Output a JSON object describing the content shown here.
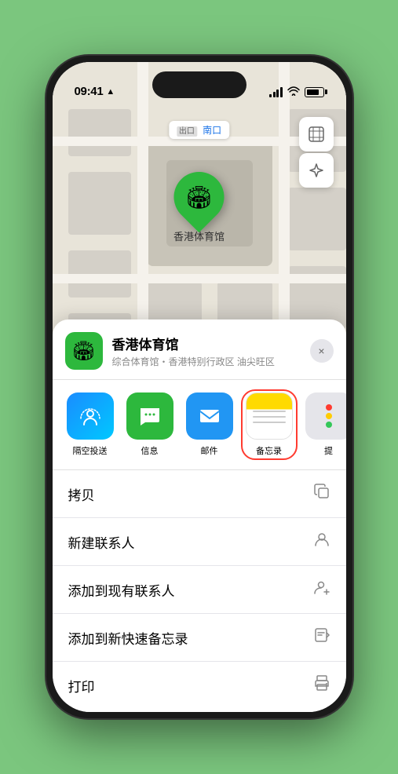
{
  "status_bar": {
    "time": "09:41",
    "location_arrow": "▶"
  },
  "map": {
    "label_prefix": "出口",
    "label_text": "南口",
    "map_label_full": "出口 南口"
  },
  "controls": {
    "map_btn": "🗺",
    "location_btn": "⬆"
  },
  "marker": {
    "label": "香港体育馆"
  },
  "sheet": {
    "venue_icon": "🏟",
    "venue_name": "香港体育馆",
    "venue_subtitle": "综合体育馆・香港特别行政区 油尖旺区",
    "close_label": "×"
  },
  "share_items": [
    {
      "id": "airdrop",
      "label": "隔空投送",
      "type": "airdrop"
    },
    {
      "id": "messages",
      "label": "信息",
      "type": "messages"
    },
    {
      "id": "mail",
      "label": "邮件",
      "type": "mail"
    },
    {
      "id": "notes",
      "label": "备忘录",
      "type": "notes",
      "selected": true
    },
    {
      "id": "more",
      "label": "提",
      "type": "more"
    }
  ],
  "actions": [
    {
      "label": "拷贝",
      "icon": "copy"
    },
    {
      "label": "新建联系人",
      "icon": "person"
    },
    {
      "label": "添加到现有联系人",
      "icon": "person-add"
    },
    {
      "label": "添加到新快速备忘录",
      "icon": "note"
    },
    {
      "label": "打印",
      "icon": "print"
    }
  ]
}
